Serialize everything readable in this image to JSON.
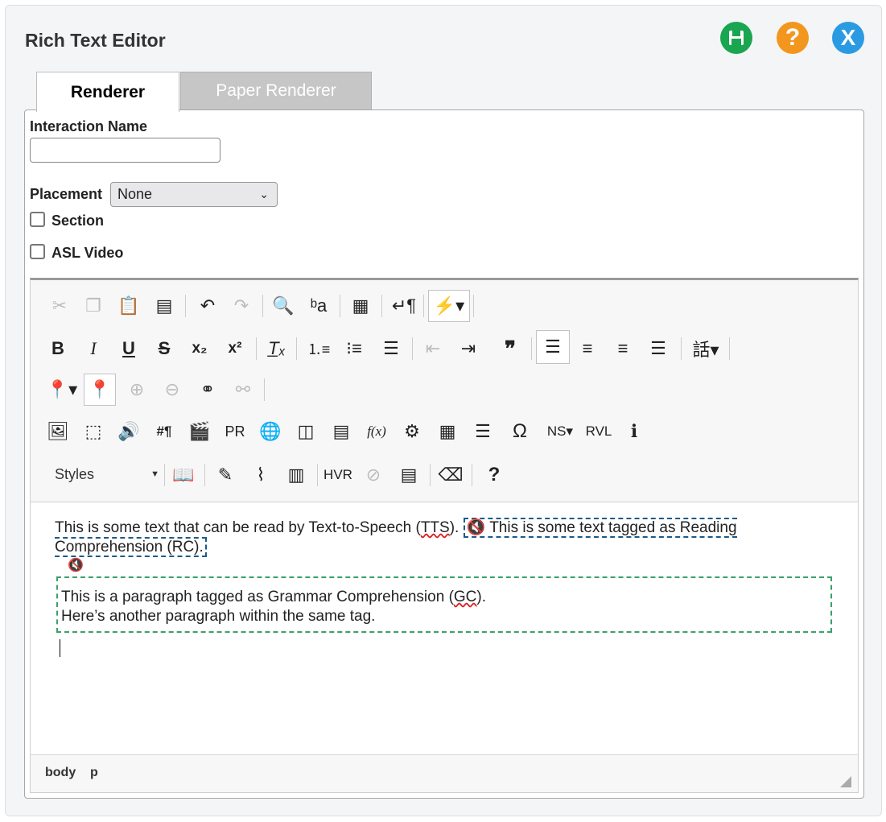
{
  "header": {
    "title": "Rich Text Editor",
    "help_glyph": "?",
    "close_glyph": "X",
    "colors": {
      "save": "#1aa551",
      "help": "#f3961e",
      "close": "#2a9be3"
    }
  },
  "tabs": [
    {
      "label": "Renderer",
      "active": true
    },
    {
      "label": "Paper Renderer",
      "active": false
    }
  ],
  "form": {
    "interaction_name_label": "Interaction Name",
    "interaction_name_value": "",
    "placement_label": "Placement",
    "placement_value": "None",
    "section_label": "Section",
    "asl_video_label": "ASL Video"
  },
  "toolbar": {
    "styles_label": "Styles",
    "text_glyphs": {
      "subscript": "x₂",
      "superscript": "x²",
      "blockquote": "❞",
      "paragraph_mark": "#¶",
      "text_direction": "PR",
      "formula": "f(x)",
      "omega": "Ω",
      "ns": "NS",
      "rvl": "RVL",
      "hvr": "HVR",
      "help": "?",
      "bold": "B",
      "italic": "I",
      "underline": "U",
      "strike": "S"
    }
  },
  "content": {
    "line1_a": "This is some text that can be read by Text-to-Speech (",
    "line1_tts": "TTS",
    "line1_b": ").",
    "rc_text": "This is some text tagged as Reading Comprehension (RC).",
    "gc_para1_a": "This is a paragraph tagged as Grammar Comprehension (",
    "gc_para1_gc": "GC",
    "gc_para1_b": ").",
    "gc_para2": "Here’s another paragraph within the same tag."
  },
  "statusbar": {
    "path": [
      "body",
      "p"
    ]
  }
}
